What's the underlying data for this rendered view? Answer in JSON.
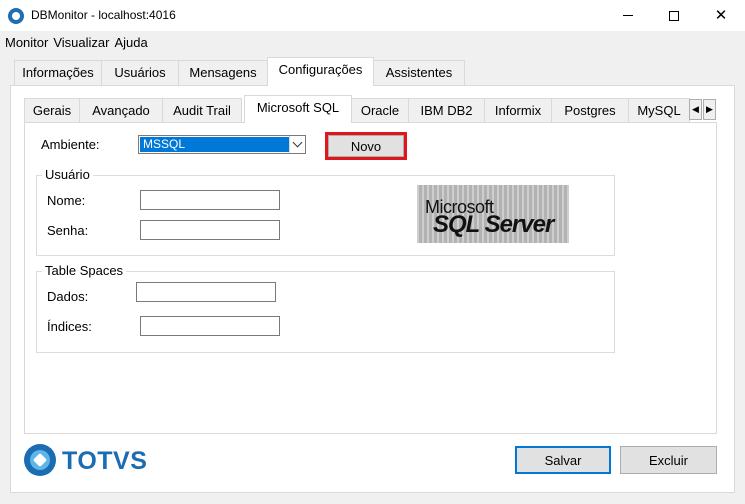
{
  "window": {
    "title": "DBMonitor - localhost:4016"
  },
  "menu": [
    "Monitor",
    "Visualizar",
    "Ajuda"
  ],
  "outer_tabs": [
    "Informações",
    "Usuários",
    "Mensagens",
    "Configurações",
    "Assistentes"
  ],
  "outer_active": "Configurações",
  "inner_tabs": [
    "Gerais",
    "Avançado",
    "Audit Trail",
    "Microsoft SQL",
    "Oracle",
    "IBM DB2",
    "Informix",
    "Postgres",
    "MySQL"
  ],
  "inner_active": "Microsoft SQL",
  "form": {
    "ambiente_label": "Ambiente:",
    "ambiente_value": "MSSQL",
    "novo_label": "Novo",
    "usuario_group": "Usuário",
    "nome_label": "Nome:",
    "nome_value": "",
    "senha_label": "Senha:",
    "senha_value": "",
    "tablespaces_group": "Table Spaces",
    "dados_label": "Dados:",
    "dados_value": "",
    "indices_label": "Índices:",
    "indices_value": ""
  },
  "logo": {
    "line1": "Microsoft",
    "line2": "SQL Server"
  },
  "brand": {
    "name": "TOTVS",
    "color": "#1b6db3"
  },
  "buttons": {
    "save": "Salvar",
    "delete": "Excluir"
  },
  "colors": {
    "selection": "#0078d7",
    "highlight": "#e0161c"
  }
}
